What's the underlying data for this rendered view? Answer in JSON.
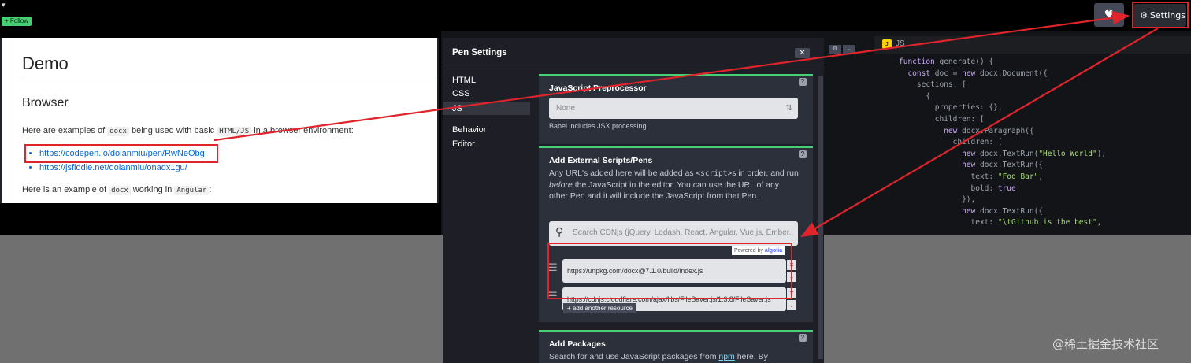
{
  "topbar": {
    "follow_label": "+ Follow",
    "heart_icon": "heart-icon",
    "settings_label": "Settings",
    "settings_icon": "gear-icon"
  },
  "preview": {
    "heading": "Demo",
    "subheading": "Browser",
    "intro": {
      "before": "Here are examples of ",
      "code1": "docx",
      "mid": " being used with basic ",
      "code2": "HTML/JS",
      "after": " in a browser environment:"
    },
    "links": [
      "https://codepen.io/dolanmiu/pen/RwNeObg",
      "https://jsfiddle.net/dolanmiu/onadx1gu/"
    ],
    "angular": {
      "before": "Here is an example of ",
      "code1": "docx",
      "mid": " working in ",
      "code2": "Angular",
      "after": ":"
    }
  },
  "editor": {
    "js_label": "JS",
    "code_lines": [
      [
        {
          "t": "function",
          "c": "kw"
        },
        {
          "t": " generate() {"
        }
      ],
      [
        {
          "t": "  "
        },
        {
          "t": "const",
          "c": "kw"
        },
        {
          "t": " doc = "
        },
        {
          "t": "new",
          "c": "kw"
        },
        {
          "t": " docx.Document({"
        }
      ],
      [
        {
          "t": "    sections: ["
        }
      ],
      [
        {
          "t": "      {"
        }
      ],
      [
        {
          "t": "        properties: {},"
        }
      ],
      [
        {
          "t": "        children: ["
        }
      ],
      [
        {
          "t": "          "
        },
        {
          "t": "new",
          "c": "kw"
        },
        {
          "t": " docx.Paragraph({"
        }
      ],
      [
        {
          "t": "            children: ["
        }
      ],
      [
        {
          "t": "              "
        },
        {
          "t": "new",
          "c": "kw"
        },
        {
          "t": " docx.TextRun("
        },
        {
          "t": "\"Hello World\"",
          "c": "str"
        },
        {
          "t": "),"
        }
      ],
      [
        {
          "t": "              "
        },
        {
          "t": "new",
          "c": "kw"
        },
        {
          "t": " docx.TextRun({"
        }
      ],
      [
        {
          "t": "                text: "
        },
        {
          "t": "\"Foo Bar\"",
          "c": "str"
        },
        {
          "t": ","
        }
      ],
      [
        {
          "t": "                bold: "
        },
        {
          "t": "true",
          "c": "kw"
        }
      ],
      [
        {
          "t": "              }),"
        }
      ],
      [
        {
          "t": "              "
        },
        {
          "t": "new",
          "c": "kw"
        },
        {
          "t": " docx.TextRun({"
        }
      ],
      [
        {
          "t": "                text: "
        },
        {
          "t": "\"\\tGithub is the best\",",
          "c": "str"
        }
      ]
    ]
  },
  "modal": {
    "title": "Pen Settings",
    "close_label": "✕",
    "nav": [
      "HTML",
      "CSS",
      "JS",
      "Behavior",
      "Editor"
    ],
    "active_nav": "JS",
    "preprocessor": {
      "title": "JavaScript Preprocessor",
      "value": "None",
      "hint": "Babel includes JSX processing."
    },
    "external": {
      "title": "Add External Scripts/Pens",
      "desc_1": "Any URL's added here will be added as ",
      "desc_code": "<script>",
      "desc_2": "s in order, and run ",
      "desc_em": "before",
      "desc_3": " the JavaScript in the editor. You can use the URL of any other Pen and it will include the JavaScript from that Pen.",
      "search_placeholder": "Search CDNjs (jQuery, Lodash, React, Angular, Vue.js, Ember.",
      "powered_by": "Powered by",
      "powered_brand": "algolia",
      "resources": [
        "https://unpkg.com/docx@7.1.0/build/index.js",
        "https://cdnjs.cloudflare.com/ajax/libs/FileSaver.js/1.3.8/FileSaver.js"
      ],
      "add_label": "+ add another resource"
    },
    "packages": {
      "title": "Add Packages",
      "desc_1": "Search for and use JavaScript packages from ",
      "desc_link": "npm",
      "desc_2": " here. By selecting a"
    },
    "help_label": "?"
  },
  "watermark": "@稀土掘金技术社区",
  "colors": {
    "accent_green": "#47cf73",
    "annotation_red": "#e0242c",
    "modal_bg": "#1e1f26",
    "card_bg": "#2c303a"
  }
}
